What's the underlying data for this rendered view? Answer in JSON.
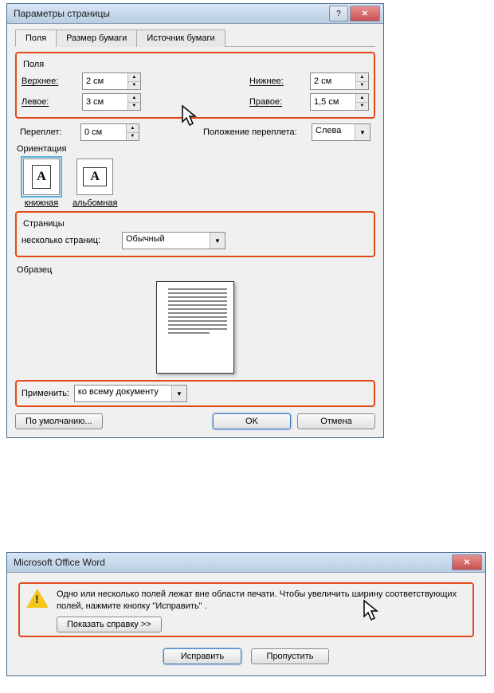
{
  "dialog1": {
    "title": "Параметры страницы",
    "tabs": [
      "Поля",
      "Размер бумаги",
      "Источник бумаги"
    ],
    "margins": {
      "group": "Поля",
      "top_label": "Верхнее:",
      "top_value": "2 см",
      "bottom_label": "Нижнее:",
      "bottom_value": "2 см",
      "left_label": "Левое:",
      "left_value": "3 см",
      "right_label": "Правое:",
      "right_value": "1,5 см"
    },
    "gutter": {
      "label": "Переплет:",
      "value": "0 см",
      "pos_label": "Положение переплета:",
      "pos_value": "Слева"
    },
    "orientation": {
      "label": "Ориентация",
      "portrait": "книжная",
      "landscape": "альбомная"
    },
    "pages": {
      "group": "Страницы",
      "multi_label": "несколько страниц:",
      "multi_value": "Обычный"
    },
    "preview_label": "Образец",
    "apply": {
      "label": "Применить:",
      "value": "ко всему документу"
    },
    "buttons": {
      "default": "По умолчанию...",
      "ok": "OK",
      "cancel": "Отмена"
    }
  },
  "dialog2": {
    "title": "Microsoft Office Word",
    "message": "Одно или несколько полей лежат вне области печати. Чтобы увеличить ширину соответствующих полей, нажмите кнопку \"Исправить\" .",
    "help": "Показать справку >>",
    "fix": "Исправить",
    "skip": "Пропустить"
  }
}
